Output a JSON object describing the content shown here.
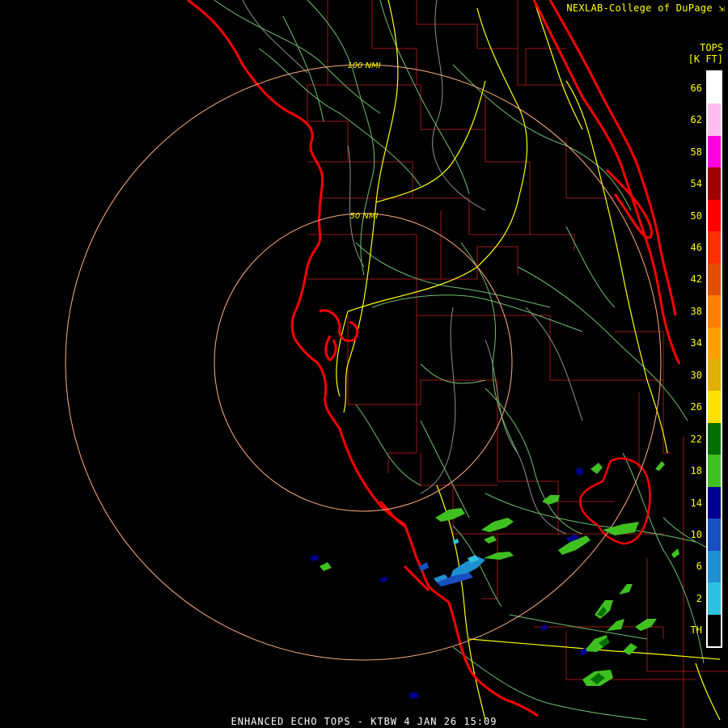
{
  "credit": "NEXLAB-College of DuPage",
  "credit_icon": "cursor-arrow-icon",
  "legend": {
    "title_line1": "TOPS",
    "title_line2": "[K FT]",
    "ticks": [
      "66",
      "62",
      "58",
      "54",
      "50",
      "46",
      "42",
      "38",
      "34",
      "30",
      "26",
      "22",
      "18",
      "14",
      "10",
      "6",
      "2",
      "TH"
    ],
    "swatch_colors": [
      "#ffffff",
      "#ffc0f0",
      "#ff00e0",
      "#a00000",
      "#ff0000",
      "#ff3000",
      "#e05000",
      "#ff8000",
      "#ffa000",
      "#e0b000",
      "#ffe000",
      "#007000",
      "#40c020",
      "#000090",
      "#1850c0",
      "#2090d0",
      "#30c0e0",
      "#000000"
    ]
  },
  "range_rings": [
    {
      "label": "100 NMI"
    },
    {
      "label": "50 NMI"
    }
  ],
  "footer": "ENHANCED ECHO TOPS - KTBW 4 JAN 26 15:09",
  "colors": {
    "coastline": "#ff0000",
    "county": "#a01818",
    "highway": "#ffff00",
    "road": "#70c070",
    "river": "#a0b0a0",
    "ring": "#ffa070"
  }
}
